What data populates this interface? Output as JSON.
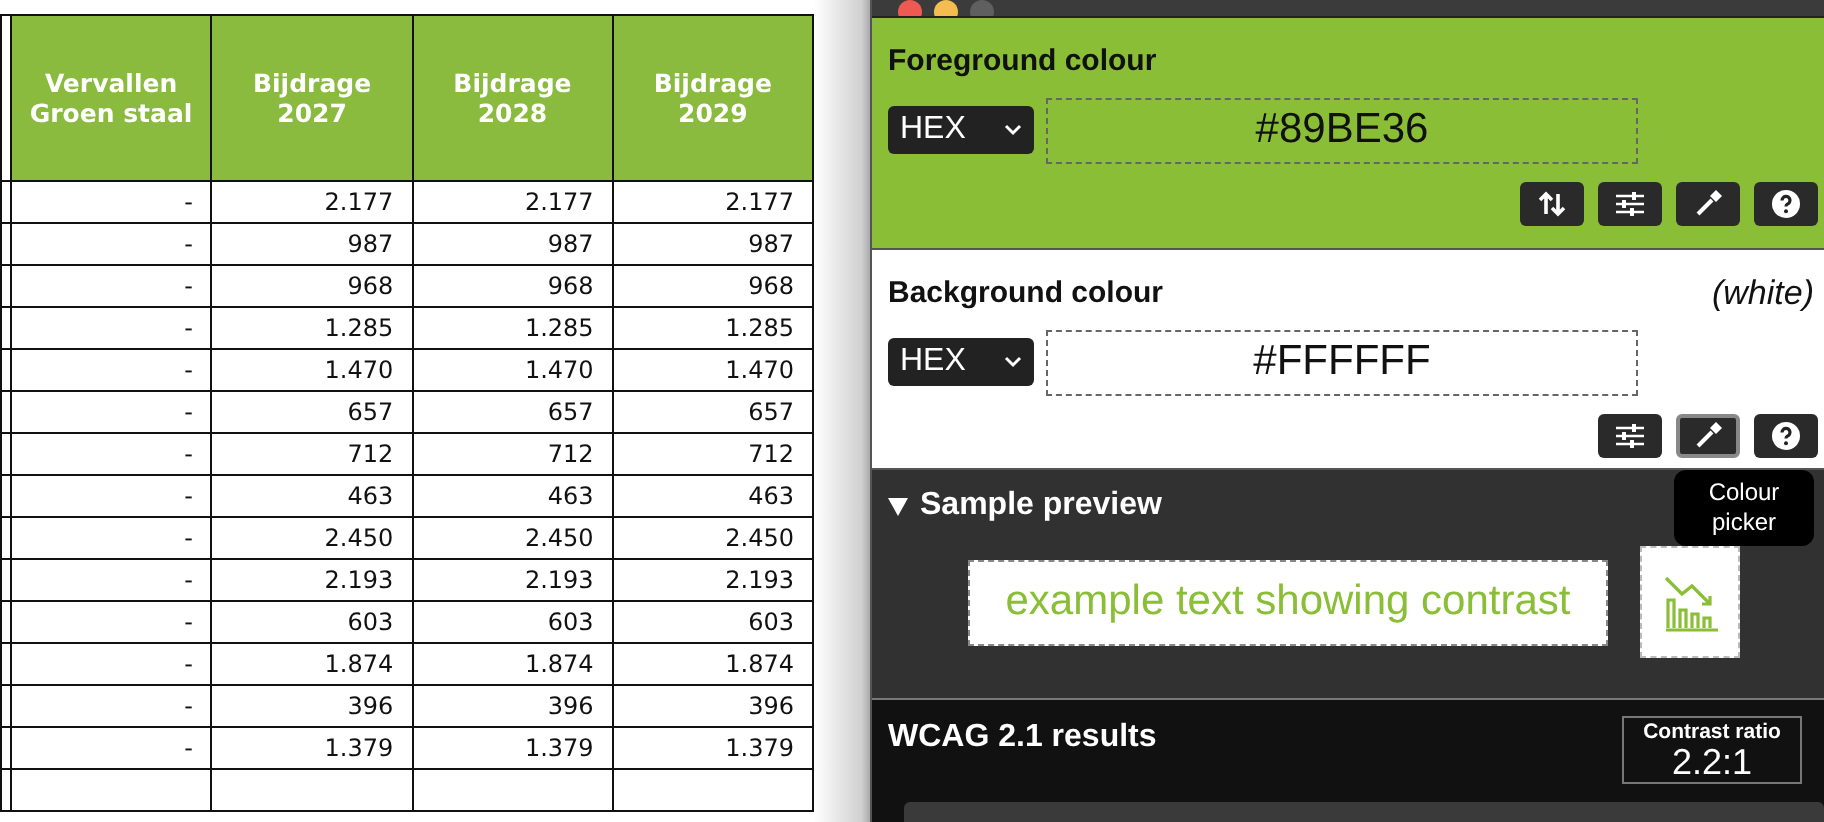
{
  "table": {
    "columns": [
      "Vervallen\nGroen staal",
      "Bijdrage\n2027",
      "Bijdrage\n2028",
      "Bijdrage\n2029"
    ],
    "rows": [
      [
        "-",
        "2.177",
        "2.177",
        "2.177"
      ],
      [
        "-",
        "987",
        "987",
        "987"
      ],
      [
        "-",
        "968",
        "968",
        "968"
      ],
      [
        "-",
        "1.285",
        "1.285",
        "1.285"
      ],
      [
        "-",
        "1.470",
        "1.470",
        "1.470"
      ],
      [
        "-",
        "657",
        "657",
        "657"
      ],
      [
        "-",
        "712",
        "712",
        "712"
      ],
      [
        "-",
        "463",
        "463",
        "463"
      ],
      [
        "-",
        "2.450",
        "2.450",
        "2.450"
      ],
      [
        "-",
        "2.193",
        "2.193",
        "2.193"
      ],
      [
        "-",
        "603",
        "603",
        "603"
      ],
      [
        "-",
        "1.874",
        "1.874",
        "1.874"
      ],
      [
        "-",
        "396",
        "396",
        "396"
      ],
      [
        "-",
        "1.379",
        "1.379",
        "1.379"
      ]
    ]
  },
  "analyser": {
    "foreground": {
      "title": "Foreground colour",
      "format": "HEX",
      "value": "#89BE36",
      "buttons": [
        {
          "kind": "swap",
          "focused": false
        },
        {
          "kind": "sliders",
          "focused": false
        },
        {
          "kind": "picker",
          "focused": false
        },
        {
          "kind": "help",
          "focused": false
        }
      ]
    },
    "background": {
      "title": "Background colour",
      "name": "(white)",
      "format": "HEX",
      "value": "#FFFFFF",
      "buttons": [
        {
          "kind": "sliders",
          "focused": false
        },
        {
          "kind": "picker",
          "focused": true
        },
        {
          "kind": "help",
          "focused": false
        }
      ]
    },
    "tooltip": "Colour\npicker",
    "sample": {
      "title": "Sample preview",
      "expanded": true,
      "text": "example text showing contrast"
    },
    "results": {
      "title": "WCAG 2.1 results",
      "ratio_label": "Contrast ratio",
      "ratio": "2.2:1"
    }
  }
}
